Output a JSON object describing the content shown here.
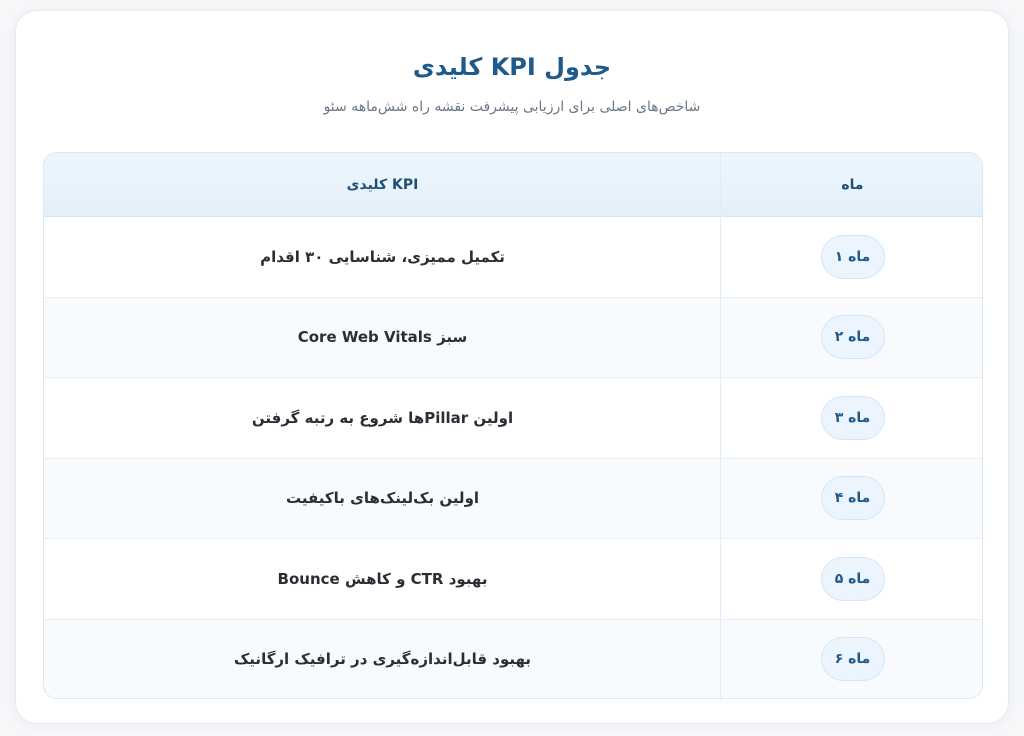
{
  "header": {
    "title": "جدول KPI کلیدی",
    "subtitle": "شاخص‌های اصلی برای ارزیابی پیشرفت نقشه راه شش‌ماهه سئو"
  },
  "table": {
    "columns": {
      "month": "ماه",
      "kpi": "KPI کلیدی"
    },
    "rows": [
      {
        "month": "ماه ۱",
        "kpi": "تکمیل ممیزی، شناسایی ۳۰ اقدام"
      },
      {
        "month": "ماه ۲",
        "kpi": "Core Web Vitals سبز"
      },
      {
        "month": "ماه ۳",
        "kpi": "اولین Pillarها شروع به رتبه گرفتن"
      },
      {
        "month": "ماه ۴",
        "kpi": "اولین بک‌لینک‌های باکیفیت"
      },
      {
        "month": "ماه ۵",
        "kpi": "بهبود CTR و کاهش Bounce"
      },
      {
        "month": "ماه ۶",
        "kpi": "بهبود قابل‌اندازه‌گیری در ترافیک ارگانیک"
      }
    ]
  },
  "colors": {
    "accent": "#1f5a8a",
    "header_bg": "#e2f0fb",
    "pill_bg": "#ecf5fd"
  }
}
